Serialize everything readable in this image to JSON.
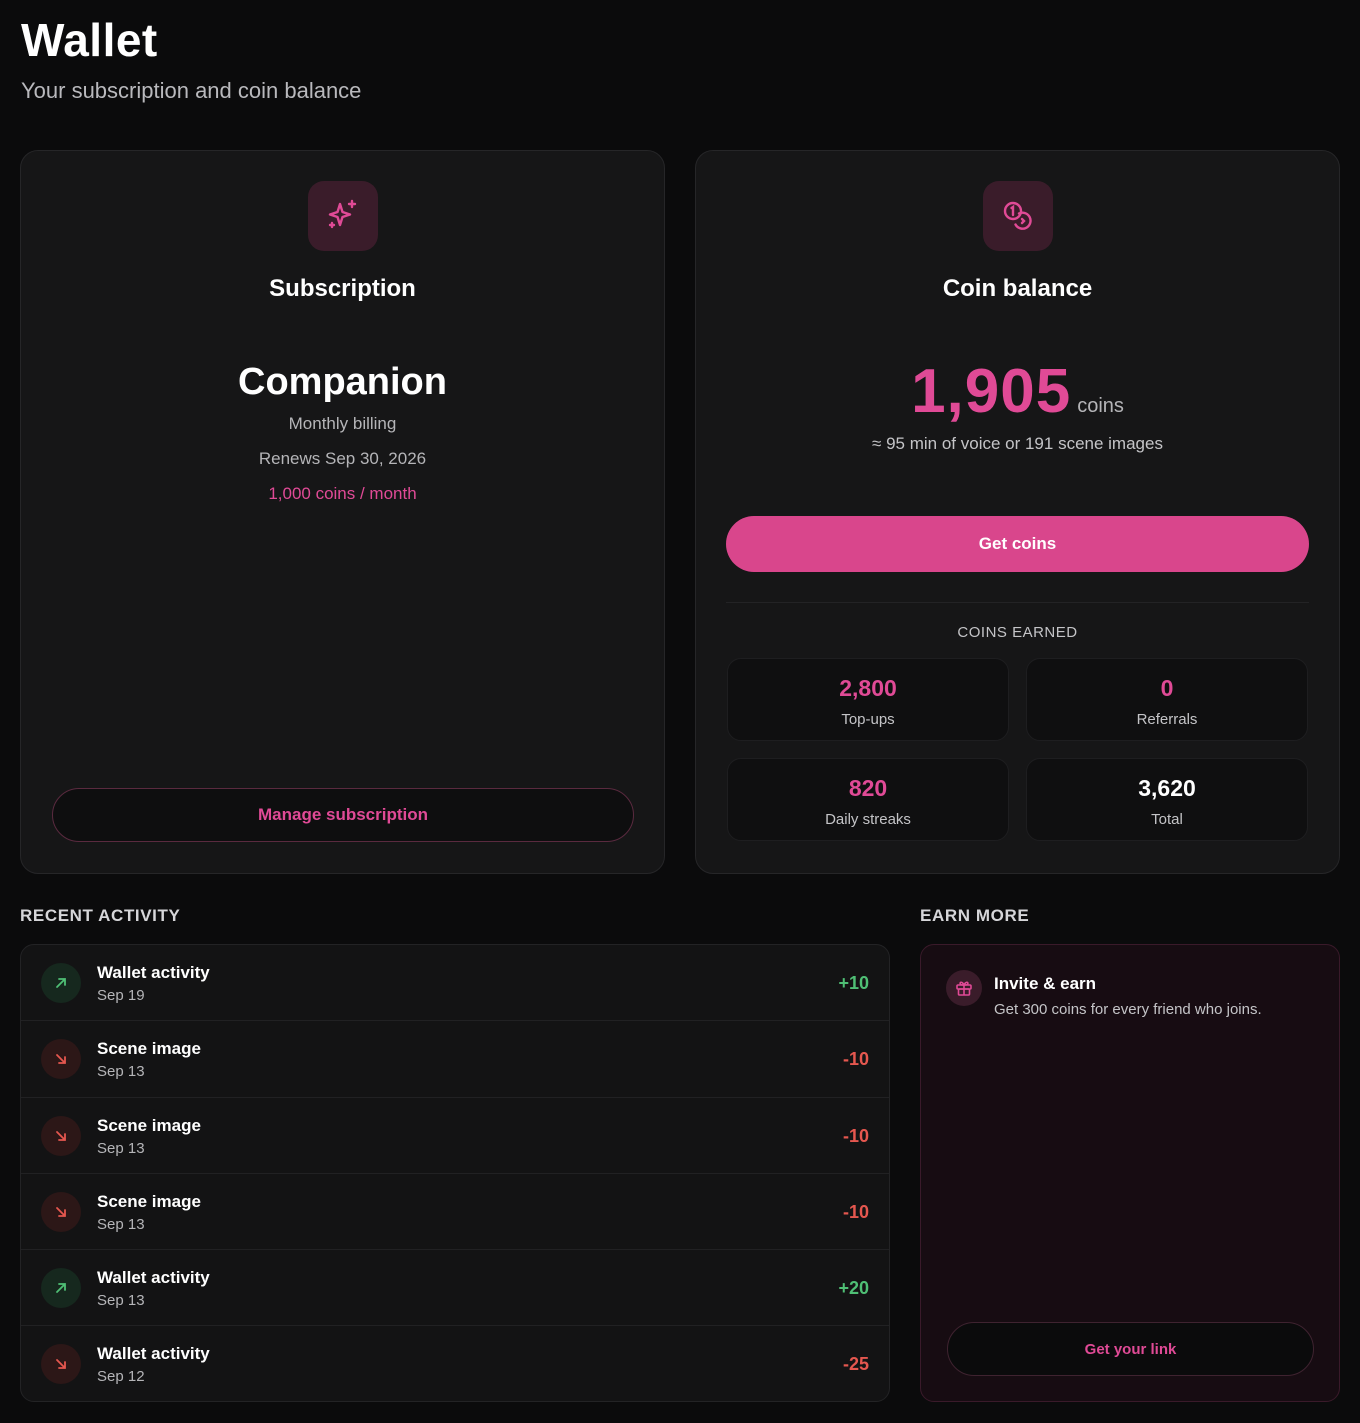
{
  "header": {
    "title": "Wallet",
    "subtitle": "Your subscription and coin balance"
  },
  "subscription": {
    "card_title": "Subscription",
    "icon": "sparkles-icon",
    "plan_name": "Companion",
    "billing": "Monthly billing",
    "renews": "Renews Sep 30, 2026",
    "coins_per_month": "1,000 coins / month",
    "manage_label": "Manage subscription"
  },
  "coin_balance": {
    "card_title": "Coin balance",
    "icon": "coins-icon",
    "amount": "1,905",
    "unit": "coins",
    "equivalent": "≈ 95 min of voice or 191 scene images",
    "get_coins_label": "Get coins",
    "earned_label": "COINS EARNED",
    "stats": [
      {
        "value": "2,800",
        "label": "Top-ups"
      },
      {
        "value": "0",
        "label": "Referrals"
      },
      {
        "value": "820",
        "label": "Daily streaks"
      },
      {
        "value": "3,620",
        "label": "Total"
      }
    ]
  },
  "recent_activity": {
    "label": "RECENT ACTIVITY",
    "items": [
      {
        "title": "Wallet activity",
        "date": "Sep 19",
        "amount": "+10",
        "direction": "up"
      },
      {
        "title": "Scene image",
        "date": "Sep 13",
        "amount": "-10",
        "direction": "down"
      },
      {
        "title": "Scene image",
        "date": "Sep 13",
        "amount": "-10",
        "direction": "down"
      },
      {
        "title": "Scene image",
        "date": "Sep 13",
        "amount": "-10",
        "direction": "down"
      },
      {
        "title": "Wallet activity",
        "date": "Sep 13",
        "amount": "+20",
        "direction": "up"
      },
      {
        "title": "Wallet activity",
        "date": "Sep 12",
        "amount": "-25",
        "direction": "down"
      }
    ]
  },
  "earn_more": {
    "label": "EARN MORE",
    "icon": "gift-icon",
    "title": "Invite & earn",
    "description": "Get 300 coins for every friend who joins.",
    "link_label": "Get your link"
  },
  "colors": {
    "accent": "#e04a96",
    "positive": "#4fbf75",
    "negative": "#e5574f",
    "background": "#0b0b0c"
  }
}
